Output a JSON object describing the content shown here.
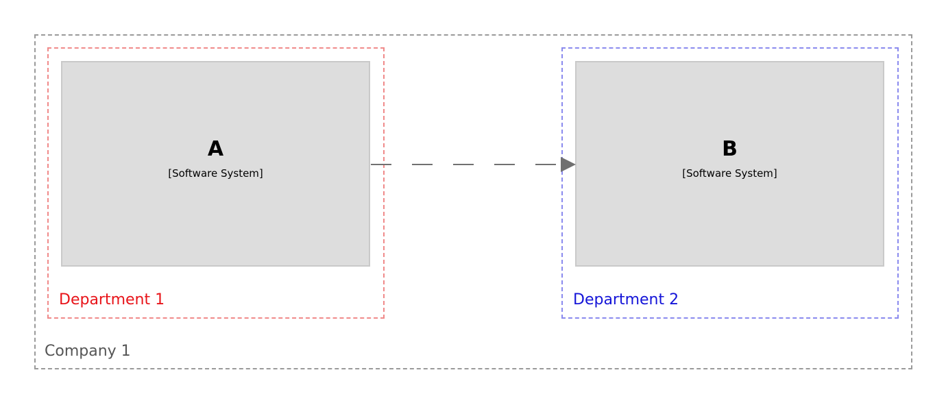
{
  "colors": {
    "company_border": "#9a9a9a",
    "company_label": "#555555",
    "department_1": "#e8141a",
    "department_1_border": "#f08a8a",
    "department_2": "#1414d8",
    "department_2_border": "#8a8aee",
    "system_fill": "#dddddd",
    "system_border": "#c9c9c9",
    "relationship": "#707070"
  },
  "company": {
    "label": "Company 1"
  },
  "departments": [
    {
      "label": "Department 1"
    },
    {
      "label": "Department 2"
    }
  ],
  "systems": [
    {
      "name": "A",
      "type": "[Software System]"
    },
    {
      "name": "B",
      "type": "[Software System]"
    }
  ],
  "relationship": {
    "from": "A",
    "to": "B",
    "style": "dashed",
    "arrowhead": "filled-triangle"
  }
}
